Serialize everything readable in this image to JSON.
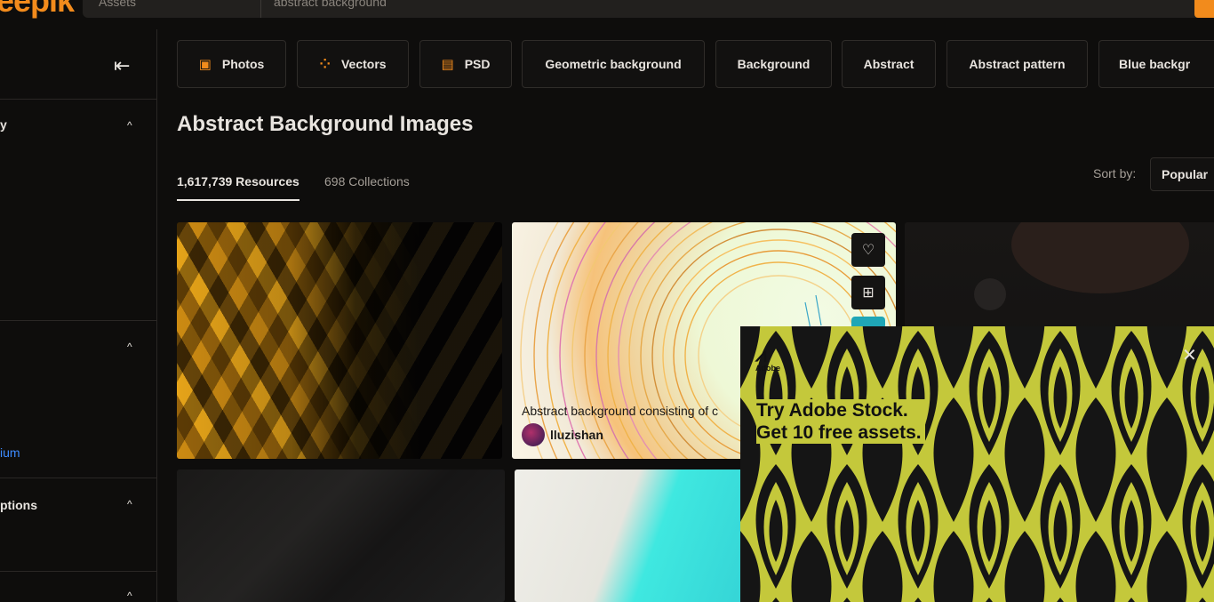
{
  "header": {
    "logo_text": "eepik",
    "search_category": "Assets",
    "search_query": "abstract background"
  },
  "sidebar": {
    "collapse_icon": "collapse-left-icon",
    "sections": [
      {
        "label": "y"
      },
      {
        "label": ""
      },
      {
        "label": "ptions"
      },
      {
        "label": ""
      }
    ],
    "premium_link": "ium"
  },
  "filters": {
    "chips": [
      {
        "label": "Photos",
        "icon": "photo-icon"
      },
      {
        "label": "Vectors",
        "icon": "vector-icon"
      },
      {
        "label": "PSD",
        "icon": "psd-icon"
      },
      {
        "label": "Geometric background"
      },
      {
        "label": "Background"
      },
      {
        "label": "Abstract"
      },
      {
        "label": "Abstract pattern"
      },
      {
        "label": "Blue backgr"
      }
    ]
  },
  "main": {
    "title": "Abstract Background Images",
    "tabs": {
      "resources": "1,617,739 Resources",
      "collections": "698 Collections"
    },
    "sort_label": "Sort by:",
    "sort_value": "Popular"
  },
  "cards": {
    "featured_caption": "Abstract background consisting of c",
    "featured_author": "lluzishan"
  },
  "ad": {
    "brand": "Adobe",
    "headline_line1": "Try Adobe Stock.",
    "headline_line2": "Get 10 free assets.",
    "close_symbol": "✕"
  },
  "colors": {
    "accent": "#f28b1c",
    "background": "#0e0d0c",
    "ad_background": "#c4c83b",
    "link": "#3d8bff"
  }
}
